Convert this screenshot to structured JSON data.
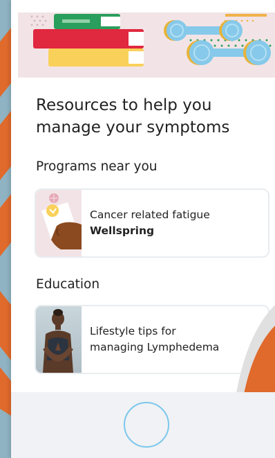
{
  "page": {
    "title": "Resources to help you manage your symptoms"
  },
  "programs": {
    "heading": "Programs near you",
    "card": {
      "line1": "Cancer related fatigue",
      "line2": "Wellspring",
      "thumbnail": "hand-holding-card-illustration"
    }
  },
  "education": {
    "heading": "Education",
    "card": {
      "line1": "Lifestyle tips for",
      "line2": "managing Lymphedema",
      "thumbnail": "woman-yoga-photo"
    }
  },
  "hero": {
    "image": "books-and-dumbbells-illustration"
  },
  "home_button": {
    "icon": "home-button-circle"
  },
  "colors": {
    "accent_orange": "#e06a2c",
    "hero_background": "#f2e4e6",
    "book_red": "#e0283f",
    "book_yellow": "#f9d15a",
    "book_green": "#2a9e5c",
    "dumbbell_blue": "#86c9ea",
    "dumbbell_gold": "#e7b33a",
    "home_button_ring": "#7cc7ec"
  }
}
